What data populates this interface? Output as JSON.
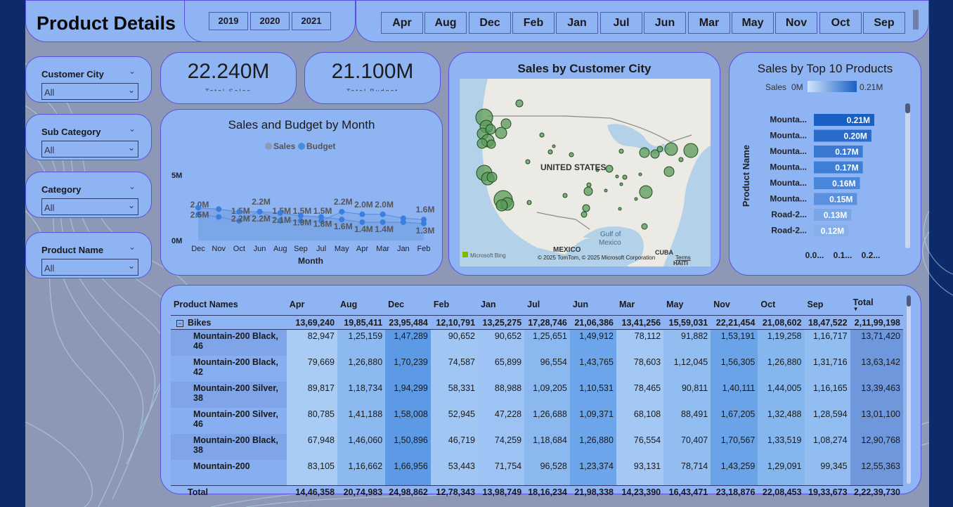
{
  "title": "Product Details",
  "years": [
    "2019",
    "2020",
    "2021"
  ],
  "months": [
    "Apr",
    "Aug",
    "Dec",
    "Feb",
    "Jan",
    "Jul",
    "Jun",
    "Mar",
    "May",
    "Nov",
    "Oct",
    "Sep"
  ],
  "slicers": [
    {
      "label": "Customer City",
      "value": "All"
    },
    {
      "label": "Sub Category",
      "value": "All"
    },
    {
      "label": "Category",
      "value": "All"
    },
    {
      "label": "Product Name",
      "value": "All"
    }
  ],
  "kpis": [
    {
      "value": "22.240M",
      "caption": "Total Sales"
    },
    {
      "value": "21.100M",
      "caption": "Total Budget"
    }
  ],
  "line_chart": {
    "title": "Sales and Budget by Month",
    "legend": [
      {
        "name": "Sales",
        "color": "#8a9bb2"
      },
      {
        "name": "Budget",
        "color": "#4a8ce0"
      }
    ],
    "y_ticks": [
      "5M",
      "0M"
    ],
    "x_label": "Month"
  },
  "map": {
    "title": "Sales by Customer City",
    "labels": [
      "UNITED STATES",
      "Gulf of",
      "Mexico",
      "MEXICO",
      "CUBA",
      "HAITI"
    ],
    "credit": "© 2025 TomTom, © 2025 Microsoft Corporation",
    "terms": "Terms",
    "bing": "Microsoft Bing"
  },
  "bar_chart": {
    "title": "Sales by Top 10 Products",
    "scale_label": "Sales",
    "scale_min": "0M",
    "scale_max": "0.21M",
    "y_axis_label": "Product Name",
    "x_ticks": [
      "0.0...",
      "0.1...",
      "0.2..."
    ]
  },
  "table": {
    "columns": [
      "Product Names",
      "Apr",
      "Aug",
      "Dec",
      "Feb",
      "Jan",
      "Jul",
      "Jun",
      "Mar",
      "May",
      "Nov",
      "Oct",
      "Sep",
      "Total"
    ],
    "group": {
      "name": "Bikes",
      "values": [
        "13,69,240",
        "19,85,411",
        "23,95,484",
        "12,10,791",
        "13,25,275",
        "17,28,746",
        "21,06,386",
        "13,41,256",
        "15,59,031",
        "22,21,454",
        "21,08,602",
        "18,47,522",
        "2,11,99,198"
      ]
    },
    "rows": [
      {
        "name": "Mountain-200 Black, 46",
        "values": [
          "82,947",
          "1,25,159",
          "1,47,289",
          "90,652",
          "90,652",
          "1,25,651",
          "1,49,912",
          "78,112",
          "91,882",
          "1,53,191",
          "1,19,258",
          "1,16,717",
          "13,71,420"
        ]
      },
      {
        "name": "Mountain-200 Black, 42",
        "values": [
          "79,669",
          "1,26,880",
          "1,70,239",
          "74,587",
          "65,899",
          "96,554",
          "1,43,765",
          "78,603",
          "1,12,045",
          "1,56,305",
          "1,26,880",
          "1,31,716",
          "13,63,142"
        ]
      },
      {
        "name": "Mountain-200 Silver, 38",
        "values": [
          "89,817",
          "1,18,734",
          "1,94,299",
          "58,331",
          "88,988",
          "1,09,205",
          "1,10,531",
          "78,465",
          "90,811",
          "1,40,111",
          "1,44,005",
          "1,16,165",
          "13,39,463"
        ]
      },
      {
        "name": "Mountain-200 Silver, 46",
        "values": [
          "80,785",
          "1,41,188",
          "1,58,008",
          "52,945",
          "47,228",
          "1,26,688",
          "1,09,371",
          "68,108",
          "88,491",
          "1,67,205",
          "1,32,488",
          "1,28,594",
          "13,01,100"
        ]
      },
      {
        "name": "Mountain-200 Black, 38",
        "values": [
          "67,948",
          "1,46,060",
          "1,50,896",
          "46,719",
          "74,259",
          "1,18,684",
          "1,26,880",
          "76,554",
          "70,407",
          "1,70,567",
          "1,33,519",
          "1,08,274",
          "12,90,768"
        ]
      },
      {
        "name": "Mountain-200",
        "values": [
          "83,105",
          "1,16,662",
          "1,66,956",
          "53,443",
          "71,754",
          "96,528",
          "1,23,374",
          "93,131",
          "78,714",
          "1,43,259",
          "1,29,091",
          "99,345",
          "12,55,363"
        ]
      }
    ],
    "total": {
      "name": "Total",
      "values": [
        "14,46,358",
        "20,74,983",
        "24,98,862",
        "12,78,343",
        "13,98,749",
        "18,16,234",
        "21,98,338",
        "14,23,390",
        "16,43,471",
        "23,18,876",
        "22,08,453",
        "19,33,673",
        "2,22,39,730"
      ]
    }
  },
  "chart_data": [
    {
      "type": "line",
      "title": "Sales and Budget by Month",
      "xlabel": "Month",
      "ylabel": "",
      "categories": [
        "Dec",
        "Nov",
        "Oct",
        "Jun",
        "Aug",
        "Sep",
        "Jul",
        "May",
        "Apr",
        "Mar",
        "Jan",
        "Feb"
      ],
      "series": [
        {
          "name": "Budget",
          "values": [
            2.0,
            1.8,
            1.5,
            2.2,
            1.5,
            1.5,
            1.5,
            2.2,
            2.0,
            2.0,
            1.7,
            1.6
          ],
          "data_labels": [
            "2.0M",
            "",
            "1.5M",
            "2.2M",
            "1.5M",
            "1.5M",
            "1.5M",
            "2.2M",
            "2.0M",
            "2.0M",
            "",
            "1.6M"
          ]
        },
        {
          "name": "Sales",
          "values": [
            2.5,
            2.4,
            2.2,
            2.2,
            2.1,
            1.9,
            1.8,
            1.6,
            1.4,
            1.4,
            1.4,
            1.3
          ],
          "data_labels": [
            "2.5M",
            "",
            "2.2M",
            "2.2M",
            "2.1M",
            "1.9M",
            "1.8M",
            "1.6M",
            "1.4M",
            "1.4M",
            "",
            "1.3M"
          ]
        }
      ],
      "y_ticks": [
        "5M",
        "0M"
      ]
    },
    {
      "type": "bar",
      "title": "Sales by Top 10 Products",
      "ylabel": "Product Name",
      "categories": [
        "Mounta...",
        "Mounta...",
        "Mounta...",
        "Mounta...",
        "Mounta...",
        "Mounta...",
        "Road-2...",
        "Road-2..."
      ],
      "values": [
        0.21,
        0.2,
        0.17,
        0.17,
        0.16,
        0.15,
        0.13,
        0.12
      ],
      "data_labels": [
        "0.21M",
        "0.20M",
        "0.17M",
        "0.17M",
        "0.16M",
        "0.15M",
        "0.13M",
        "0.12M"
      ],
      "x_ticks": [
        "0.0...",
        "0.1...",
        "0.2..."
      ],
      "color_scale": [
        "0M",
        "0.21M"
      ]
    }
  ]
}
